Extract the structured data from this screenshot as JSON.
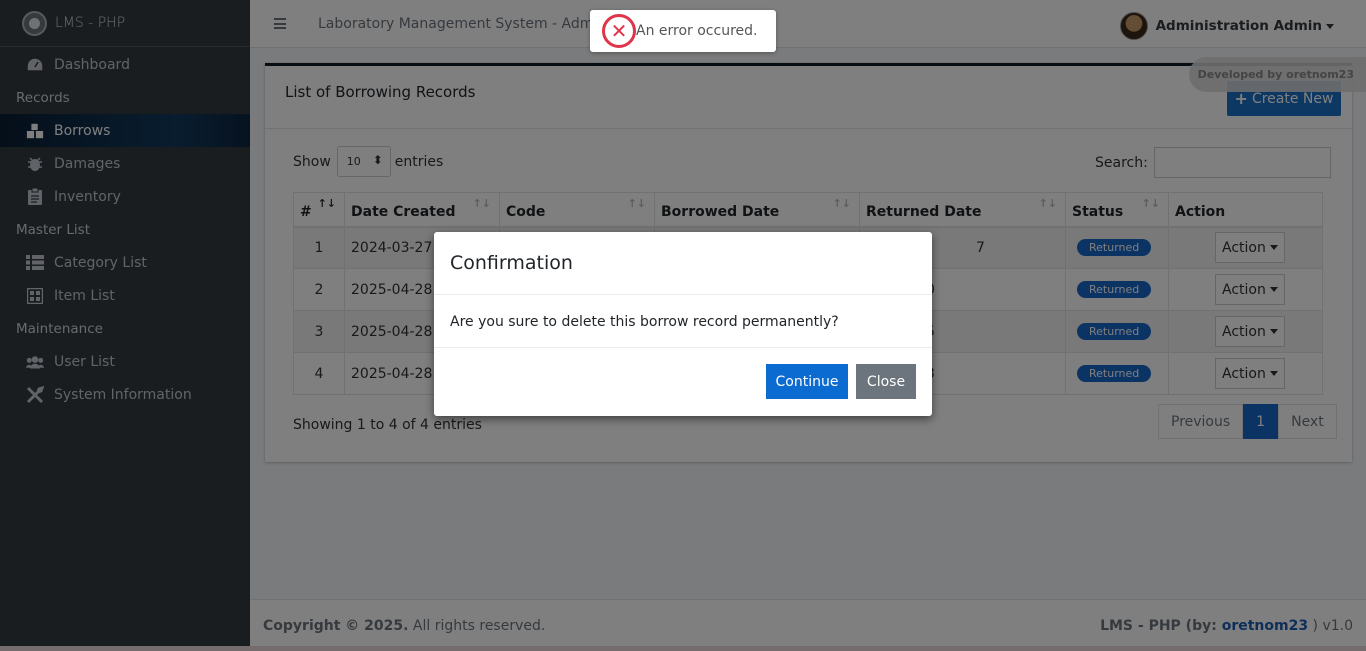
{
  "sidebar": {
    "brand": "LMS - PHP",
    "items": [
      {
        "label": "Dashboard"
      },
      {
        "header": "Records"
      },
      {
        "label": "Borrows"
      },
      {
        "label": "Damages"
      },
      {
        "label": "Inventory"
      },
      {
        "header": "Master List"
      },
      {
        "label": "Category List"
      },
      {
        "label": "Item List"
      },
      {
        "header": "Maintenance"
      },
      {
        "label": "User List"
      },
      {
        "label": "System Information"
      }
    ]
  },
  "topbar": {
    "title": "Laboratory Management System - Admin",
    "user": "Administration Admin"
  },
  "toast": {
    "message": "An error occured."
  },
  "card": {
    "title": "List of Borrowing Records",
    "create_label": "Create New",
    "developed_by": "Developed by oretnom23"
  },
  "table_controls": {
    "show": "Show",
    "entries_value": "10",
    "entries": "entries",
    "search": "Search:"
  },
  "table": {
    "headers": [
      "#",
      "Date Created",
      "Code",
      "Borrowed Date",
      "Returned Date",
      "Status",
      "Action"
    ],
    "rows": [
      {
        "num": "1",
        "date": "2024-03-27 1",
        "returned_tail": "7",
        "status": "Returned",
        "action": "Action"
      },
      {
        "num": "2",
        "date": "2025-04-28 1",
        "returned_tail": "0",
        "status": "Returned",
        "action": "Action"
      },
      {
        "num": "3",
        "date": "2025-04-28 1",
        "returned_tail": "5",
        "status": "Returned",
        "action": "Action"
      },
      {
        "num": "4",
        "date": "2025-04-28 1",
        "returned_tail": "3",
        "status": "Returned",
        "action": "Action"
      }
    ]
  },
  "pagination": {
    "showing": "Showing 1 to 4 of 4 entries",
    "previous": "Previous",
    "page": "1",
    "next": "Next"
  },
  "footer": {
    "copyright_bold": "Copyright © 2025.",
    "copyright_rest": " All rights reserved.",
    "right_prefix": "LMS - PHP (by: ",
    "right_link": "oretnom23",
    "right_suffix": " ) v1.0"
  },
  "modal": {
    "title": "Confirmation",
    "body": "Are you sure to delete this borrow record permanently?",
    "continue": "Continue",
    "close": "Close"
  }
}
